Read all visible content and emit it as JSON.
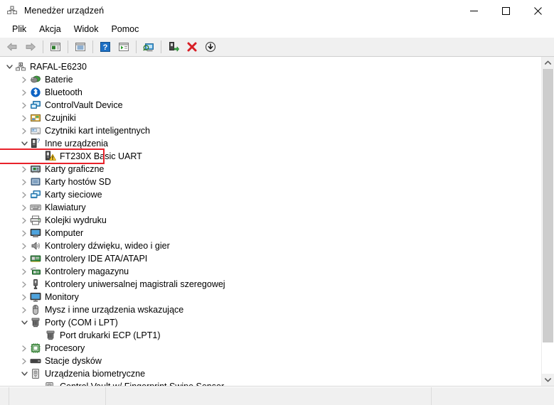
{
  "window": {
    "title": "Menedżer urządzeń",
    "title_icon": "device-manager-icon",
    "minimize_label": "—",
    "maximize_label": "☐",
    "close_label": "✕"
  },
  "menubar": {
    "items": [
      {
        "label": "Plik",
        "name": "menu-file"
      },
      {
        "label": "Akcja",
        "name": "menu-action"
      },
      {
        "label": "Widok",
        "name": "menu-view"
      },
      {
        "label": "Pomoc",
        "name": "menu-help"
      }
    ]
  },
  "toolbar": {
    "buttons": [
      {
        "name": "back-icon",
        "title": "Wstecz"
      },
      {
        "name": "forward-icon",
        "title": "Dalej"
      },
      {
        "name": "separator-1",
        "title": ""
      },
      {
        "name": "properties-icon",
        "title": "Właściwości"
      },
      {
        "name": "separator-2",
        "title": ""
      },
      {
        "name": "show-list-icon",
        "title": "Pokaż listę"
      },
      {
        "name": "separator-3",
        "title": ""
      },
      {
        "name": "help-icon",
        "title": "Pomoc"
      },
      {
        "name": "update-driver-icon",
        "title": "Aktualizuj sterownik"
      },
      {
        "name": "separator-4",
        "title": ""
      },
      {
        "name": "scan-hardware-changes-icon",
        "title": "Skanuj w poszukiwaniu zmian sprzętu"
      },
      {
        "name": "separator-5",
        "title": ""
      },
      {
        "name": "enable-device-icon",
        "title": "Włącz urządzenie"
      },
      {
        "name": "uninstall-device-icon",
        "title": "Odinstaluj urządzenie"
      },
      {
        "name": "disable-device-icon",
        "title": "Wyłącz urządzenie"
      }
    ]
  },
  "tree": {
    "nodes": [
      {
        "label": "RAFAL-E6230",
        "depth": 0,
        "state": "expanded",
        "icon": "computer-root-icon",
        "highlight": false
      },
      {
        "label": "Baterie",
        "depth": 1,
        "state": "collapsed",
        "icon": "battery-icon",
        "highlight": false
      },
      {
        "label": "Bluetooth",
        "depth": 1,
        "state": "collapsed",
        "icon": "bluetooth-icon",
        "highlight": false
      },
      {
        "label": "ControlVault Device",
        "depth": 1,
        "state": "collapsed",
        "icon": "controlvault-icon",
        "highlight": false
      },
      {
        "label": "Czujniki",
        "depth": 1,
        "state": "collapsed",
        "icon": "sensors-icon",
        "highlight": false
      },
      {
        "label": "Czytniki kart inteligentnych",
        "depth": 1,
        "state": "collapsed",
        "icon": "smartcard-reader-icon",
        "highlight": false
      },
      {
        "label": "Inne urządzenia",
        "depth": 1,
        "state": "expanded",
        "icon": "unknown-device-icon",
        "highlight": false
      },
      {
        "label": "FT230X Basic UART",
        "depth": 2,
        "state": "leaf",
        "icon": "unknown-device-warning-icon",
        "highlight": true
      },
      {
        "label": "Karty graficzne",
        "depth": 1,
        "state": "collapsed",
        "icon": "display-adapter-icon",
        "highlight": false
      },
      {
        "label": "Karty hostów SD",
        "depth": 1,
        "state": "collapsed",
        "icon": "sd-host-icon",
        "highlight": false
      },
      {
        "label": "Karty sieciowe",
        "depth": 1,
        "state": "collapsed",
        "icon": "network-adapter-icon",
        "highlight": false
      },
      {
        "label": "Klawiatury",
        "depth": 1,
        "state": "collapsed",
        "icon": "keyboard-icon",
        "highlight": false
      },
      {
        "label": "Kolejki wydruku",
        "depth": 1,
        "state": "collapsed",
        "icon": "printer-icon",
        "highlight": false
      },
      {
        "label": "Komputer",
        "depth": 1,
        "state": "collapsed",
        "icon": "computer-icon",
        "highlight": false
      },
      {
        "label": "Kontrolery dźwięku, wideo i gier",
        "depth": 1,
        "state": "collapsed",
        "icon": "sound-icon",
        "highlight": false
      },
      {
        "label": "Kontrolery IDE ATA/ATAPI",
        "depth": 1,
        "state": "collapsed",
        "icon": "ide-controller-icon",
        "highlight": false
      },
      {
        "label": "Kontrolery magazynu",
        "depth": 1,
        "state": "collapsed",
        "icon": "storage-controller-icon",
        "highlight": false
      },
      {
        "label": "Kontrolery uniwersalnej magistrali szeregowej",
        "depth": 1,
        "state": "collapsed",
        "icon": "usb-icon",
        "highlight": false
      },
      {
        "label": "Monitory",
        "depth": 1,
        "state": "collapsed",
        "icon": "monitor-icon",
        "highlight": false
      },
      {
        "label": "Mysz i inne urządzenia wskazujące",
        "depth": 1,
        "state": "collapsed",
        "icon": "mouse-icon",
        "highlight": false
      },
      {
        "label": "Porty (COM i LPT)",
        "depth": 1,
        "state": "expanded",
        "icon": "port-icon",
        "highlight": false
      },
      {
        "label": "Port drukarki ECP (LPT1)",
        "depth": 2,
        "state": "leaf",
        "icon": "port-icon",
        "highlight": false
      },
      {
        "label": "Procesory",
        "depth": 1,
        "state": "collapsed",
        "icon": "processor-icon",
        "highlight": false
      },
      {
        "label": "Stacje dysków",
        "depth": 1,
        "state": "collapsed",
        "icon": "disk-drive-icon",
        "highlight": false
      },
      {
        "label": "Urządzenia biometryczne",
        "depth": 1,
        "state": "expanded",
        "icon": "biometric-icon",
        "highlight": false
      },
      {
        "label": "Control Vault w/ Fingerprint Swipe Sensor",
        "depth": 2,
        "state": "leaf",
        "icon": "biometric-device-icon",
        "highlight": false
      }
    ]
  },
  "scrollbar": {
    "up_arrow": "chevron-up-icon",
    "down_arrow": "chevron-down-icon"
  },
  "statusbar": {
    "cells": [
      "",
      "",
      "",
      ""
    ]
  },
  "colors": {
    "highlight_border": "#e8222a",
    "toolbar_bg": "#f0f0f0",
    "warning_yellow": "#ffd23a",
    "close_hover": "#e81123"
  }
}
